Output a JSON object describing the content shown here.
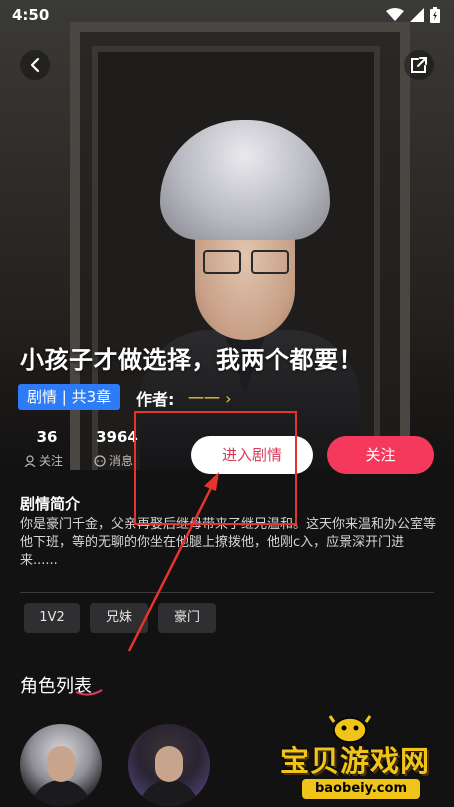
{
  "status_bar": {
    "time": "4:50"
  },
  "story": {
    "title": "小孩子才做选择，我两个都要！",
    "tag": "剧情 | 共3章",
    "author_label": "作者:",
    "author_name": "一一 ›"
  },
  "stats": [
    {
      "value": "36",
      "label": "关注",
      "icon": "user-icon"
    },
    {
      "value": "3964",
      "label": "消息",
      "icon": "message-icon"
    }
  ],
  "actions": {
    "enter_label": "进入剧情",
    "follow_label": "关注"
  },
  "synopsis": {
    "title": "剧情简介",
    "text": "你是豪门千金，父亲再娶后继母带来了继兄温和。这天你来温和办公室等他下班，等的无聊的你坐在他腿上撩拨他，他刚c入，应景深开门进来......"
  },
  "tags": [
    "1V2",
    "兄妹",
    "豪门"
  ],
  "roles": {
    "title": "角色列表"
  },
  "watermark": {
    "text": "宝贝游戏网",
    "url": "baobeiy.com"
  },
  "colors": {
    "accent_red": "#f4395c",
    "tag_blue": "#2d7bf6",
    "author_gold": "#f2c641",
    "annotation": "#e5342c"
  }
}
